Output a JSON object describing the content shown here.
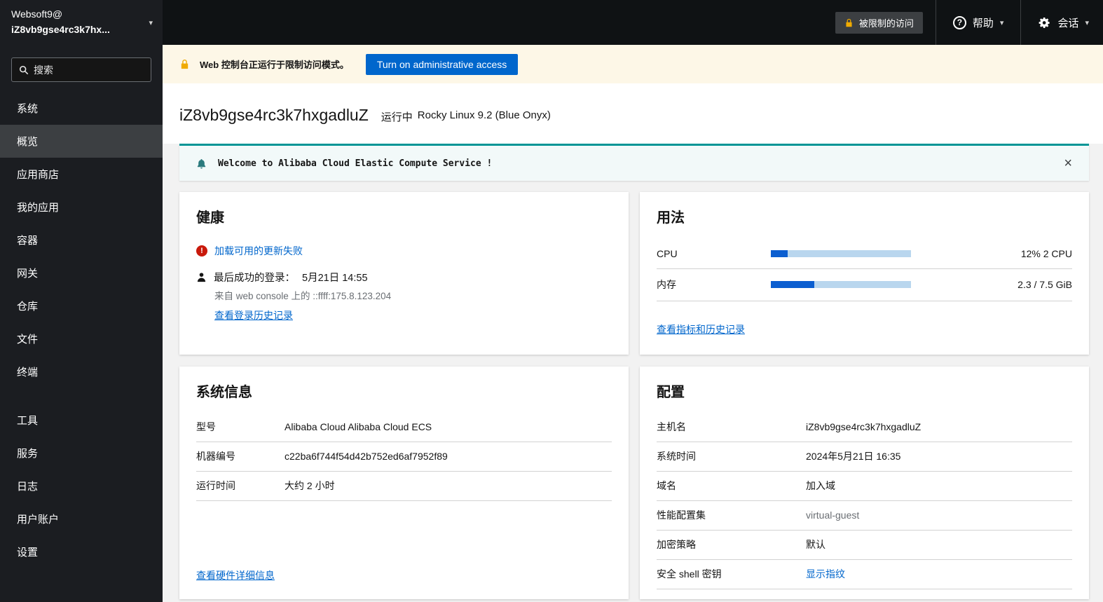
{
  "brand": {
    "org": "Websoft9@",
    "host": "iZ8vb9gse4rc3k7hx..."
  },
  "topbar": {
    "restricted_label": "被限制的访问",
    "help_label": "帮助",
    "session_label": "会话"
  },
  "search": {
    "placeholder": "搜索"
  },
  "sidebar": {
    "items": [
      {
        "label": "系统"
      },
      {
        "label": "概览"
      },
      {
        "label": "应用商店"
      },
      {
        "label": "我的应用"
      },
      {
        "label": "容器"
      },
      {
        "label": "网关"
      },
      {
        "label": "仓库"
      },
      {
        "label": "文件"
      },
      {
        "label": "终端"
      },
      {
        "label": "工具"
      },
      {
        "label": "服务"
      },
      {
        "label": "日志"
      },
      {
        "label": "用户账户"
      },
      {
        "label": "设置"
      }
    ]
  },
  "banner": {
    "message": "Web 控制台正运行于限制访问模式。",
    "button_label": "Turn on administrative access"
  },
  "header": {
    "hostname": "iZ8vb9gse4rc3k7hxgadluZ",
    "state": "运行中",
    "os": "Rocky Linux 9.2 (Blue Onyx)"
  },
  "motd": {
    "message": "Welcome to Alibaba Cloud Elastic Compute Service !"
  },
  "health": {
    "title": "健康",
    "updates_error": "加载可用的更新失败",
    "last_login_label": "最后成功的登录：",
    "last_login_time": "5月21日 14:55",
    "login_source": "来自 web console 上的 ::ffff:175.8.123.204",
    "history_link": "查看登录历史记录"
  },
  "usage": {
    "title": "用法",
    "cpu_label": "CPU",
    "cpu_percent": 12,
    "cpu_value": "12% 2 CPU",
    "mem_label": "内存",
    "mem_percent": 31,
    "mem_value": "2.3 / 7.5 GiB",
    "metrics_link": "查看指标和历史记录"
  },
  "system_info": {
    "title": "系统信息",
    "rows": [
      {
        "label": "型号",
        "value": "Alibaba Cloud Alibaba Cloud ECS"
      },
      {
        "label": "机器编号",
        "value": "c22ba6f744f54d42b752ed6af7952f89"
      },
      {
        "label": "运行时间",
        "value": "大约 2 小时"
      }
    ],
    "hardware_link": "查看硬件详细信息"
  },
  "config": {
    "title": "配置",
    "rows": [
      {
        "label": "主机名",
        "value": "iZ8vb9gse4rc3k7hxgadluZ"
      },
      {
        "label": "系统时间",
        "value": "2024年5月21日 16:35"
      },
      {
        "label": "域名",
        "value": "加入域"
      },
      {
        "label": "性能配置集",
        "value": "virtual-guest"
      },
      {
        "label": "加密策略",
        "value": "默认"
      },
      {
        "label": "安全 shell 密钥",
        "value": "显示指纹"
      }
    ]
  },
  "colors": {
    "accent_blue": "#0066cc",
    "alert_teal": "#009596",
    "warning_gold": "#f0ab00",
    "error_red": "#c9190b"
  }
}
